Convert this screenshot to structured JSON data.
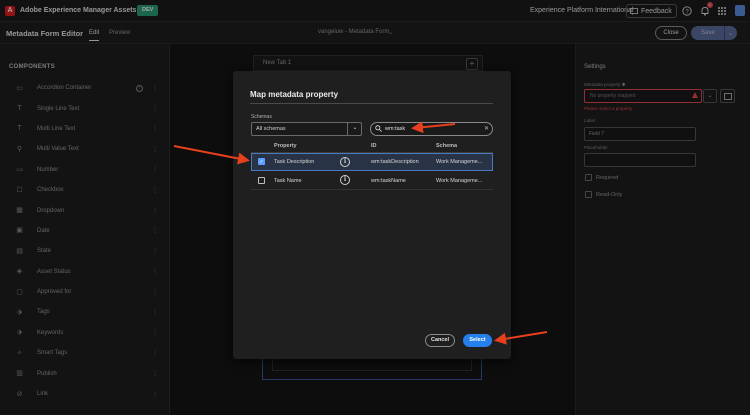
{
  "topbar": {
    "logo_letter": "A",
    "app_title": "Adobe Experience Manager Assets",
    "env_badge": "DEV",
    "org_name": "Experience Platform International",
    "feedback_label": "Feedback",
    "notification_count": "1"
  },
  "editor": {
    "title": "Metadata Form Editor",
    "tab_edit": "Edit",
    "tab_preview": "Preview",
    "form_name": "vangeluw - Metadata Form",
    "close_label": "Close",
    "save_label": "Save"
  },
  "components": {
    "title": "COMPONENTS",
    "items": [
      {
        "label": "Accordion Container",
        "icon": "accordion-icon",
        "glyph": "▭"
      },
      {
        "label": "Single Line Text",
        "icon": "text-icon",
        "glyph": "T"
      },
      {
        "label": "Multi Line Text",
        "icon": "text-icon",
        "glyph": "T"
      },
      {
        "label": "Multi Value Text",
        "icon": "multi-value-icon",
        "glyph": "⚲"
      },
      {
        "label": "Number",
        "icon": "number-icon",
        "glyph": "123"
      },
      {
        "label": "Checkbox",
        "icon": "checkbox-icon",
        "glyph": "☐"
      },
      {
        "label": "Dropdown",
        "icon": "dropdown-icon",
        "glyph": "▦"
      },
      {
        "label": "Date",
        "icon": "calendar-icon",
        "glyph": "▣"
      },
      {
        "label": "State",
        "icon": "state-icon",
        "glyph": "▤"
      },
      {
        "label": "Asset Status",
        "icon": "asset-status-icon",
        "glyph": "◈"
      },
      {
        "label": "Approved for",
        "icon": "approved-icon",
        "glyph": "▢"
      },
      {
        "label": "Tags",
        "icon": "tag-icon",
        "glyph": "⬗"
      },
      {
        "label": "Keywords",
        "icon": "keyword-icon",
        "glyph": "⬗"
      },
      {
        "label": "Smart Tags",
        "icon": "smart-tag-icon",
        "glyph": "✧"
      },
      {
        "label": "Publish",
        "icon": "publish-icon",
        "glyph": "▥"
      },
      {
        "label": "Link",
        "icon": "link-icon",
        "glyph": "⊘"
      }
    ]
  },
  "canvas": {
    "tab_label": "New Tab 1",
    "add_label": "+"
  },
  "settings": {
    "title": "Settings",
    "metadata_property_label": "Metadata property",
    "metadata_property_placeholder": "No property mapped",
    "metadata_property_error": "Please select a property",
    "label_label": "Label",
    "label_value": "Field 7",
    "placeholder_label": "Placeholder",
    "required_label": "Required",
    "readonly_label": "Read-Only"
  },
  "dialog": {
    "title": "Map metadata property",
    "schemas_label": "Schemas",
    "schemas_value": "All schemas",
    "search_value": "wm:task",
    "columns": [
      "Property",
      "ID",
      "Schema"
    ],
    "rows": [
      {
        "property": "Task Description",
        "id": "wm:taskDescription",
        "schema": "Work Manageme...",
        "checked": true
      },
      {
        "property": "Task Name",
        "id": "wm:taskName",
        "schema": "Work Manageme...",
        "checked": false
      }
    ],
    "cancel_label": "Cancel",
    "select_label": "Select"
  },
  "colors": {
    "accent": "#2680eb",
    "annotation_arrow": "#e8401c",
    "error": "#e34850",
    "dev_badge": "#2d9d78"
  }
}
